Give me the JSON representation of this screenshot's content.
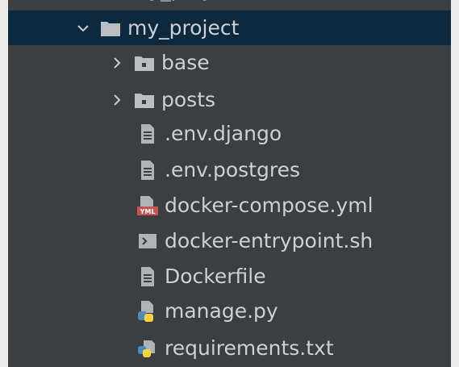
{
  "tree": {
    "cut_label": "my_project",
    "root": {
      "label": "my_project",
      "expanded": true,
      "icon": "folder-icon"
    },
    "items": [
      {
        "name": "tree-item-base",
        "label": "base",
        "type": "folder",
        "icon": "package-folder-icon",
        "collapsed": true
      },
      {
        "name": "tree-item-posts",
        "label": "posts",
        "type": "folder",
        "icon": "package-folder-icon",
        "collapsed": true
      },
      {
        "name": "tree-item-env-django",
        "label": ".env.django",
        "type": "file",
        "icon": "text-file-icon"
      },
      {
        "name": "tree-item-env-postgres",
        "label": ".env.postgres",
        "type": "file",
        "icon": "text-file-icon"
      },
      {
        "name": "tree-item-docker-compose",
        "label": "docker-compose.yml",
        "type": "file",
        "icon": "yml-file-icon",
        "badge": "YML"
      },
      {
        "name": "tree-item-docker-entrypoint",
        "label": "docker-entrypoint.sh",
        "type": "file",
        "icon": "shell-script-icon"
      },
      {
        "name": "tree-item-dockerfile",
        "label": "Dockerfile",
        "type": "file",
        "icon": "text-file-icon"
      },
      {
        "name": "tree-item-manage-py",
        "label": "manage.py",
        "type": "file",
        "icon": "python-file-icon"
      },
      {
        "name": "tree-item-requirements",
        "label": "requirements.txt",
        "type": "file",
        "icon": "requirements-file-icon"
      }
    ]
  },
  "colors": {
    "panel_bg": "#3c3f41",
    "selection_bg": "#0d293e",
    "text": "#cdd0d3",
    "icon_gray": "#aeb3b8",
    "yml_red": "#c75450",
    "python_blue": "#4b8bbe",
    "python_yellow": "#ffd43b"
  }
}
